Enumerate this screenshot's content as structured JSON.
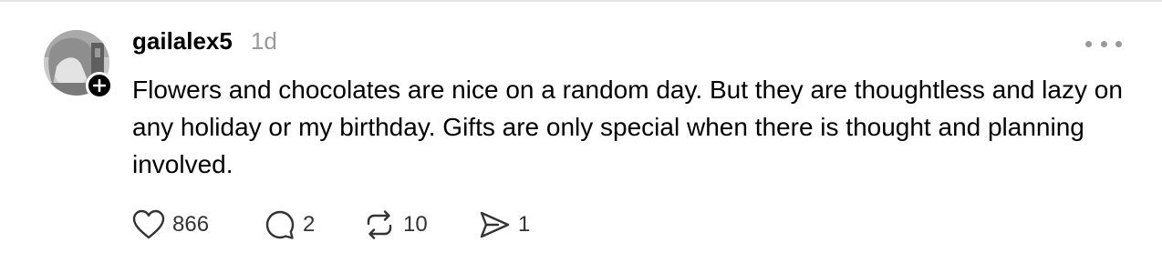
{
  "post": {
    "username": "gailalex5",
    "timestamp": "1d",
    "text": "Flowers and chocolates are nice on a random day. But they are thoughtless and lazy on any holiday or my birthday. Gifts are only special when there is thought and planning involved.",
    "actions": {
      "likes": "866",
      "comments": "2",
      "reposts": "10",
      "shares": "1"
    }
  },
  "icons": {
    "avatar": "profile-photo",
    "follow_badge": "plus-icon",
    "more": "ellipsis-icon",
    "like": "heart-icon",
    "comment": "speech-bubble-icon",
    "repost": "repost-arrows-icon",
    "share": "paper-plane-icon"
  },
  "colors": {
    "text": "#000000",
    "muted": "#9a9a9a",
    "icon": "#333333",
    "divider": "#e6e6e6"
  }
}
